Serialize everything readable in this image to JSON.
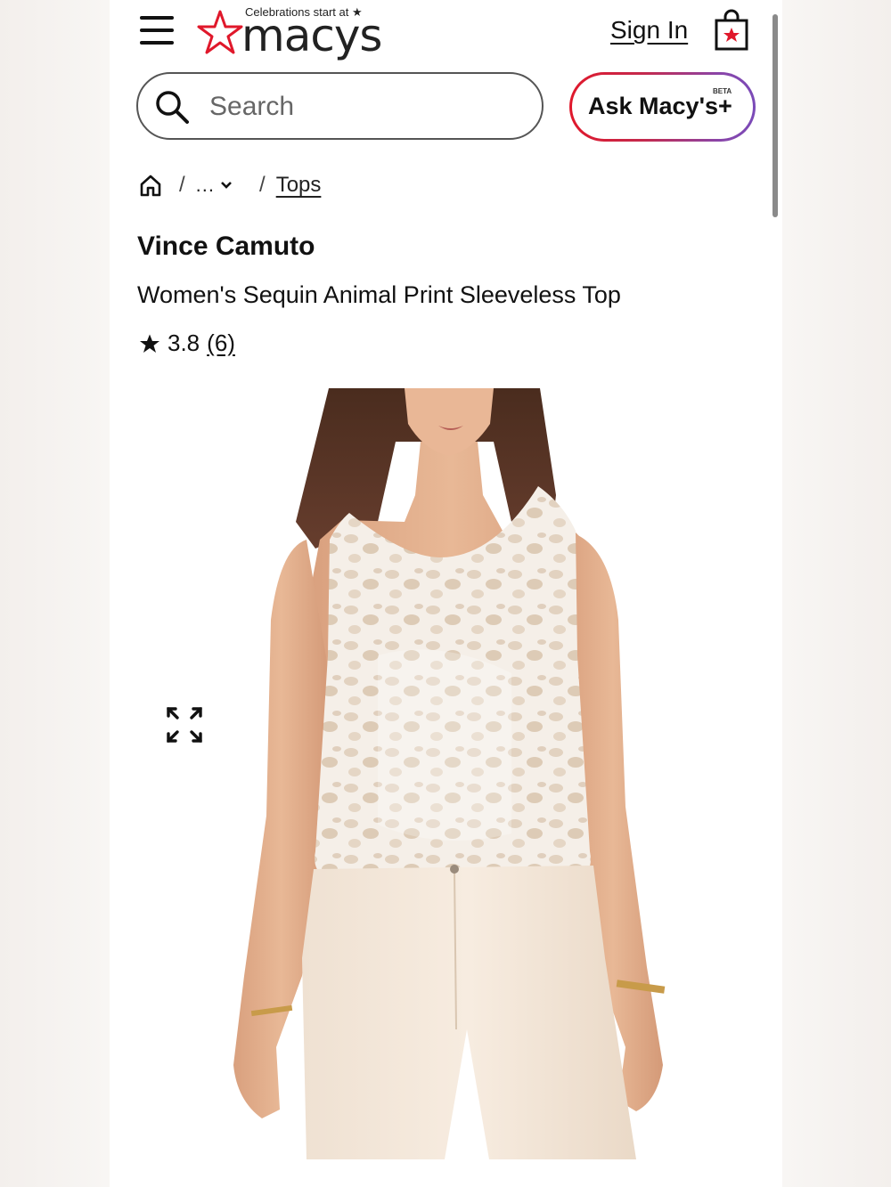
{
  "header": {
    "logo_tagline": "Celebrations start at ★",
    "logo_word": "macys",
    "sign_in": "Sign In"
  },
  "search": {
    "placeholder": "Search"
  },
  "ask_macys": {
    "label": "Ask Macy's+",
    "badge": "BETA"
  },
  "breadcrumb": {
    "sep": "/",
    "more": "...",
    "current": "Tops"
  },
  "product": {
    "brand": "Vince Camuto",
    "title": "Women's Sequin Animal Print Sleeveless Top",
    "rating": "3.8",
    "review_count": "(6)"
  },
  "colors": {
    "brand_red": "#e0182b",
    "accent_purple": "#7a4ab8"
  },
  "icons": [
    "menu-icon",
    "macys-star-logo",
    "shopping-bag-icon",
    "search-icon",
    "home-icon",
    "chevron-down-icon",
    "star-icon",
    "expand-icon"
  ]
}
